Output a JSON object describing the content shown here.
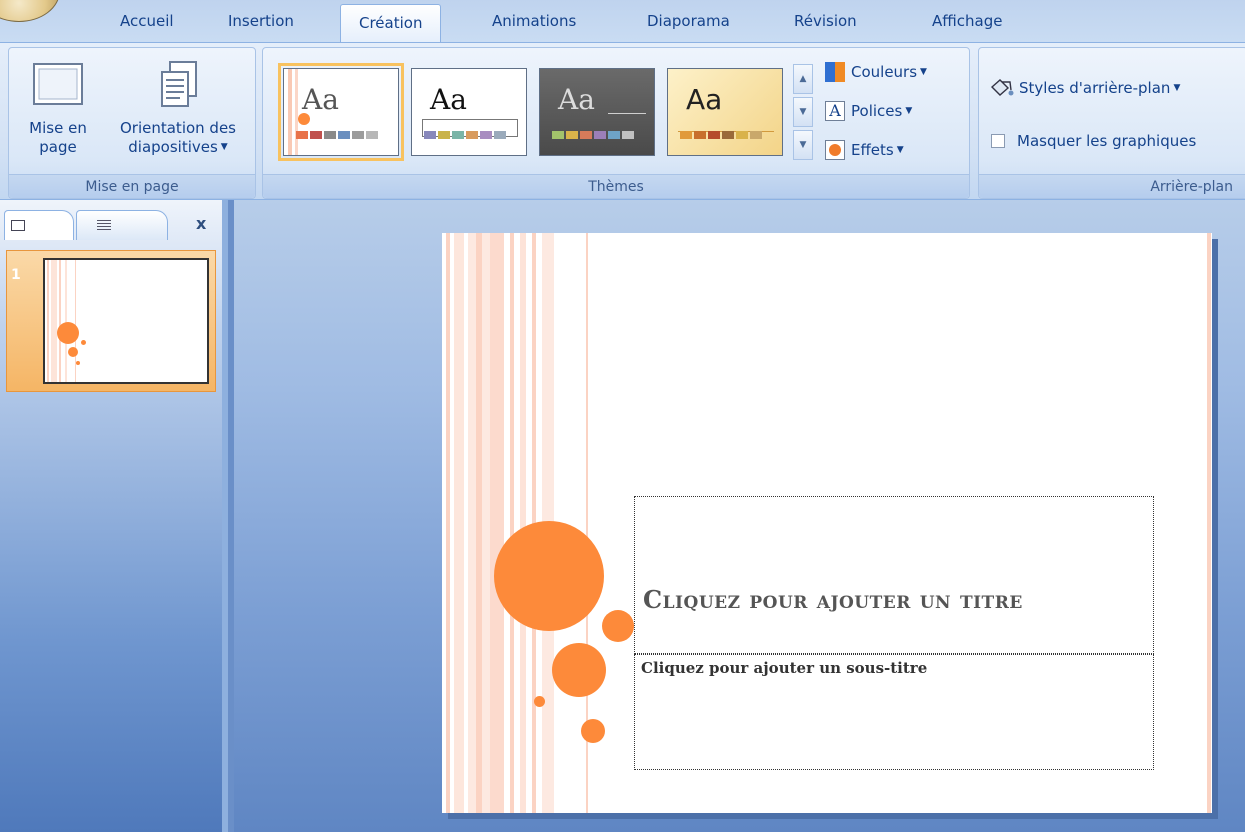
{
  "tabs": [
    {
      "label": "Accueil"
    },
    {
      "label": "Insertion"
    },
    {
      "label": "Création"
    },
    {
      "label": "Animations"
    },
    {
      "label": "Diaporama"
    },
    {
      "label": "Révision"
    },
    {
      "label": "Affichage"
    }
  ],
  "ribbon": {
    "mise_en_page": {
      "label": "Mise en page",
      "page_setup": {
        "line1": "Mise en",
        "line2": "page"
      },
      "orientation": {
        "line1": "Orientation des",
        "line2": "diapositives"
      }
    },
    "themes": {
      "label": "Thèmes",
      "preview_text": "Aa",
      "couleurs": "Couleurs",
      "polices": "Polices",
      "effets": "Effets"
    },
    "arriere_plan": {
      "label": "Arrière-plan",
      "styles": "Styles d'arrière-plan",
      "masquer": "Masquer les graphiques"
    }
  },
  "panel": {
    "slide_number": "1",
    "close": "x"
  },
  "slide": {
    "title": "Cliquez pour ajouter un titre",
    "subtitle": "Cliquez pour ajouter un sous-titre"
  },
  "colors": {
    "accent_orange": "#fd8a3a",
    "ribbon_text": "#15428b",
    "stripe_pink": "#fbd3c3"
  }
}
